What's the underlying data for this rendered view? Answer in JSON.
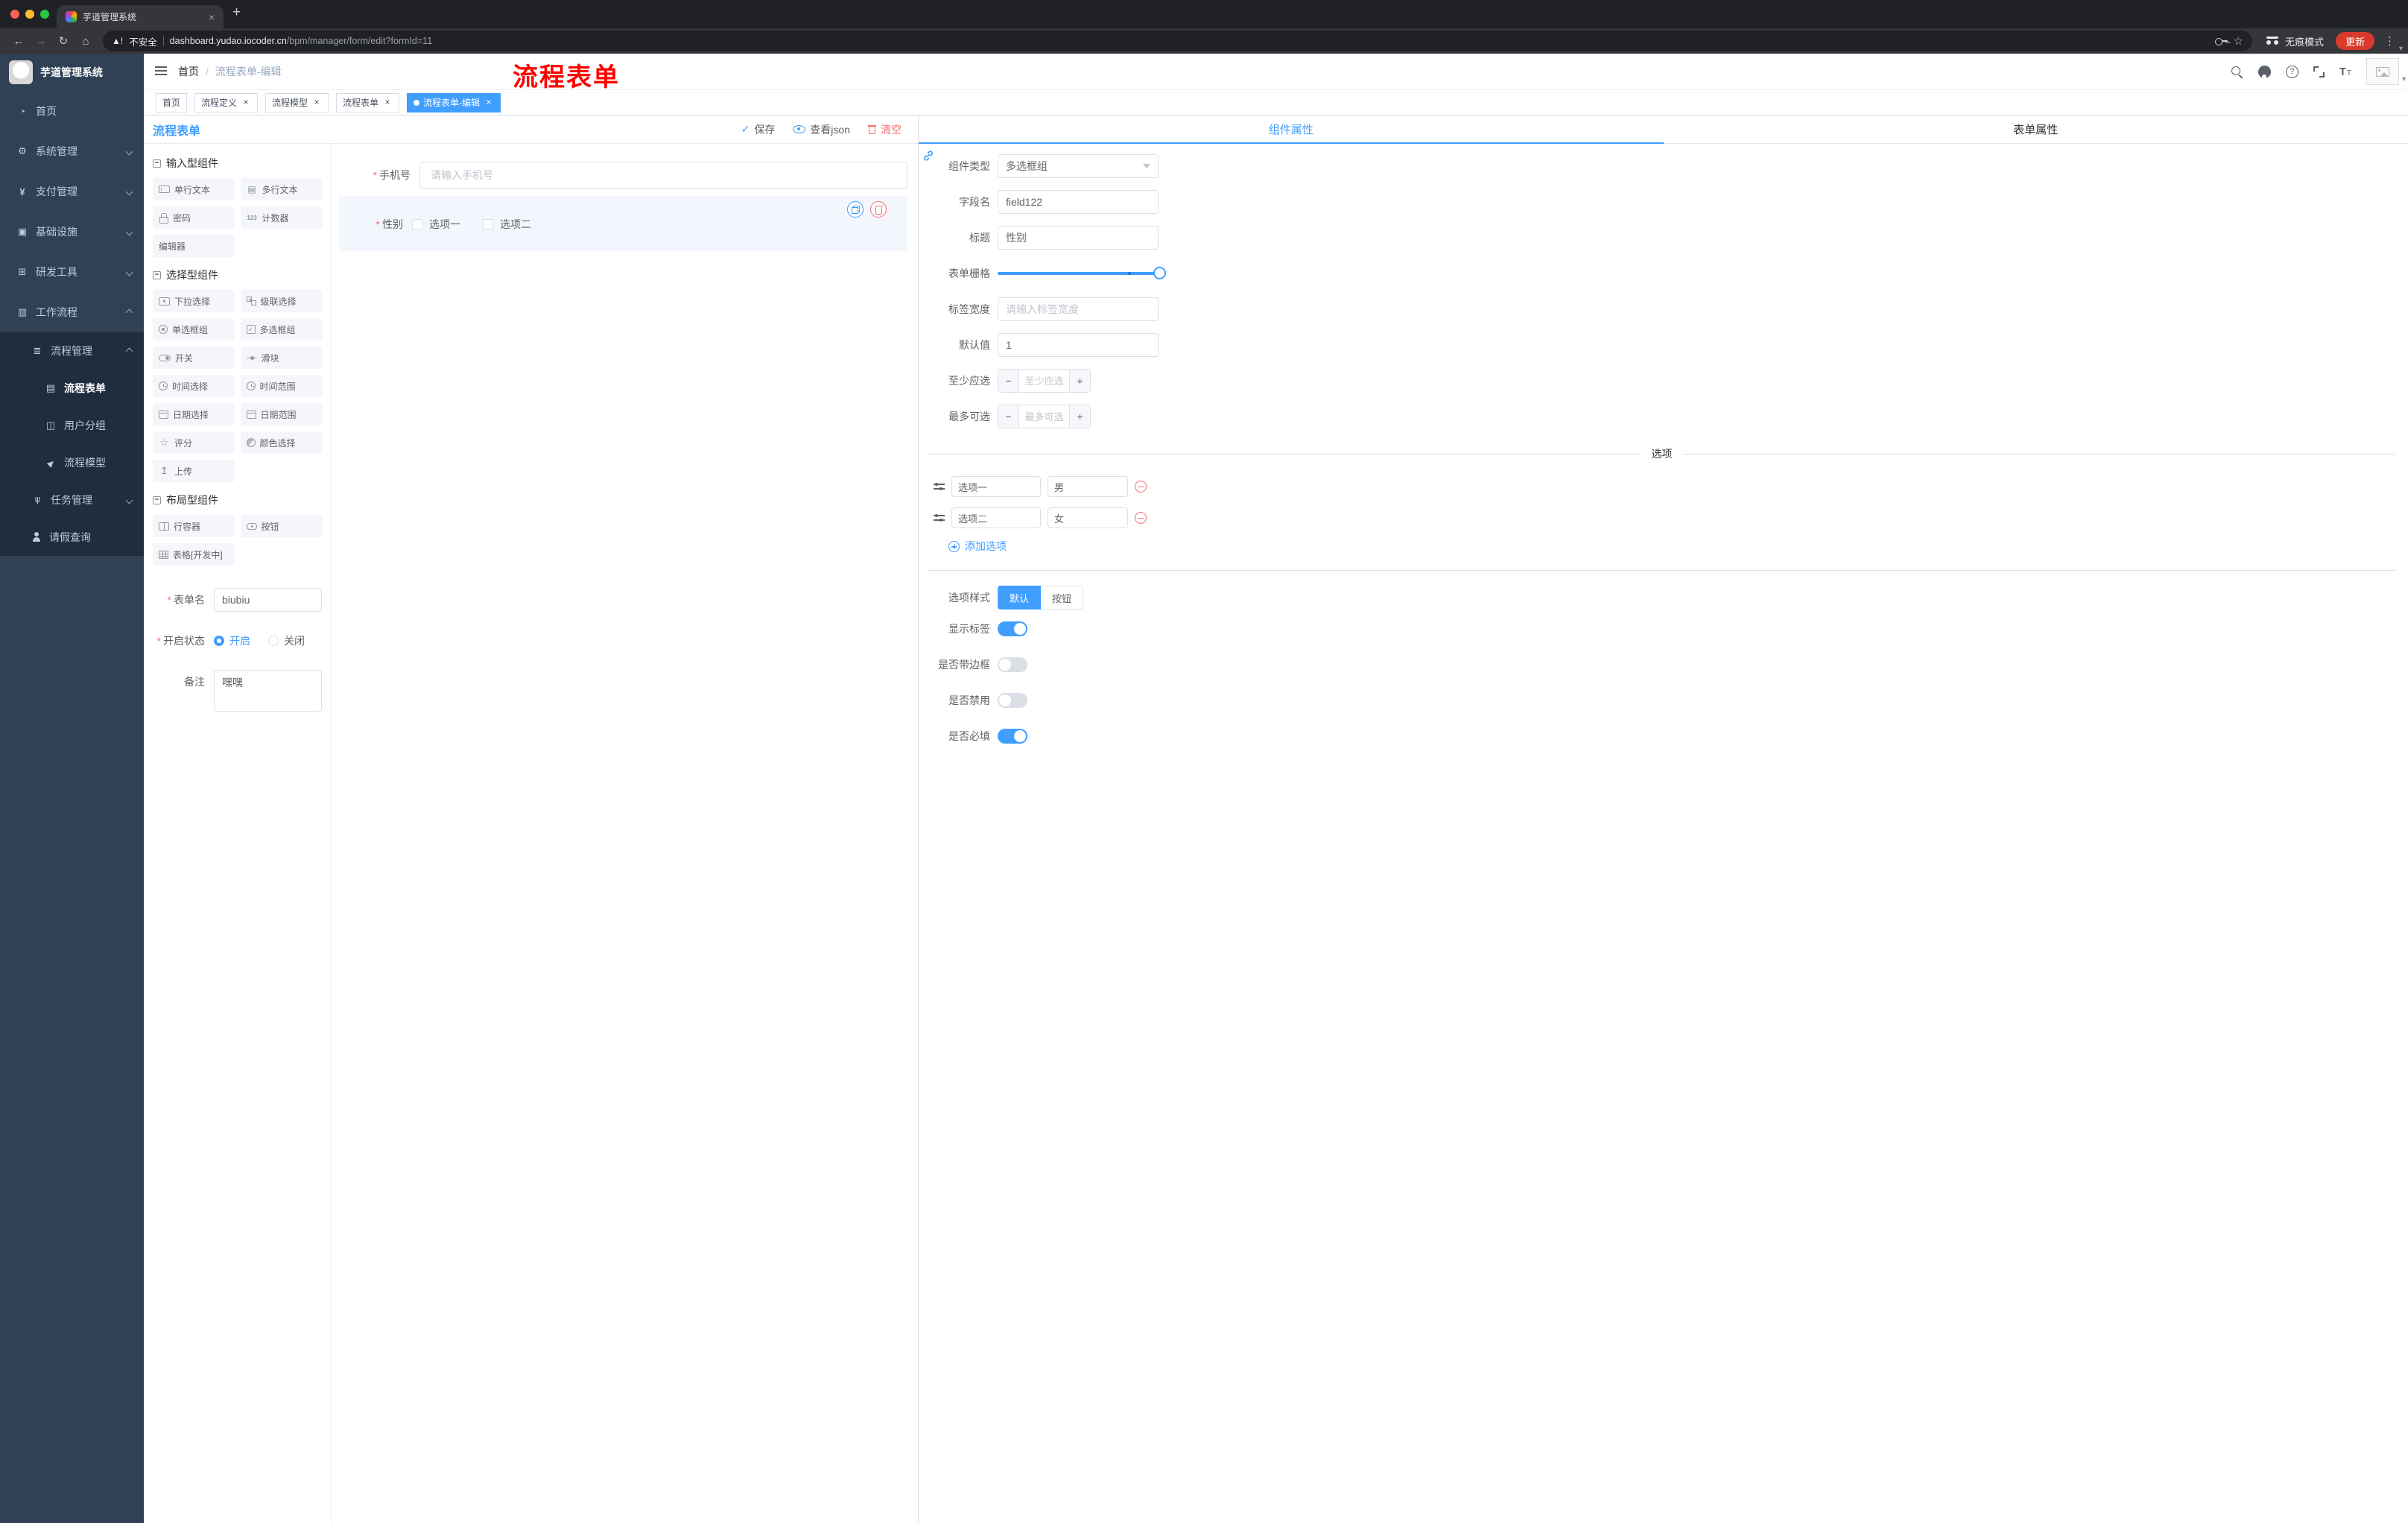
{
  "browser": {
    "tab": {
      "title": "芋道管理系统"
    },
    "address": {
      "security": "不安全",
      "domain": "dashboard.yudao.iocoder.cn",
      "path": "/bpm/manager/form/edit?formId=11",
      "incognito": "无痕模式",
      "update": "更新"
    }
  },
  "sidebar": {
    "logo": "芋道管理系统",
    "menu": [
      {
        "label": "首页",
        "icon": "dashboard"
      },
      {
        "label": "系统管理",
        "icon": "gear"
      },
      {
        "label": "支付管理",
        "icon": "yen"
      },
      {
        "label": "基础设施",
        "icon": "infrastructure"
      },
      {
        "label": "研发工具",
        "icon": "tools"
      },
      {
        "label": "工作流程",
        "icon": "workflow"
      },
      {
        "label": "流程管理",
        "icon": "list"
      },
      {
        "label": "流程表单",
        "icon": "document"
      },
      {
        "label": "用户分组",
        "icon": "users"
      },
      {
        "label": "流程模型",
        "icon": "send"
      },
      {
        "label": "任务管理",
        "icon": "branch"
      },
      {
        "label": "请假查询",
        "icon": "user"
      }
    ]
  },
  "header": {
    "breadcrumb": {
      "home": "首页",
      "current": "流程表单-编辑"
    },
    "annotation": "流程表单",
    "icon_buttons": [
      "search",
      "github",
      "help",
      "fullscreen",
      "font-size",
      "avatar"
    ]
  },
  "tags": [
    {
      "label": "首页",
      "closable": false,
      "active": false
    },
    {
      "label": "流程定义",
      "closable": true,
      "active": false
    },
    {
      "label": "流程模型",
      "closable": true,
      "active": false
    },
    {
      "label": "流程表单",
      "closable": true,
      "active": false
    },
    {
      "label": "流程表单-编辑",
      "closable": true,
      "active": true
    }
  ],
  "designer": {
    "title": "流程表单",
    "actions": {
      "save": "保存",
      "view_json": "查看json",
      "clear": "清空"
    },
    "palette": {
      "sections": [
        {
          "title": "输入型组件",
          "items": [
            {
              "label": "单行文本",
              "icon": "input"
            },
            {
              "label": "多行文本",
              "icon": "textarea"
            },
            {
              "label": "密码",
              "icon": "lock"
            },
            {
              "label": "计数器",
              "icon": "counter"
            },
            {
              "label": "编辑器",
              "icon": "editor"
            }
          ]
        },
        {
          "title": "选择型组件",
          "items": [
            {
              "label": "下拉选择",
              "icon": "select"
            },
            {
              "label": "级联选择",
              "icon": "cascader"
            },
            {
              "label": "单选框组",
              "icon": "radio"
            },
            {
              "label": "多选框组",
              "icon": "checkbox"
            },
            {
              "label": "开关",
              "icon": "switch"
            },
            {
              "label": "滑块",
              "icon": "slider"
            },
            {
              "label": "时间选择",
              "icon": "time"
            },
            {
              "label": "时间范围",
              "icon": "time-range"
            },
            {
              "label": "日期选择",
              "icon": "date"
            },
            {
              "label": "日期范围",
              "icon": "date-range"
            },
            {
              "label": "评分",
              "icon": "rate"
            },
            {
              "label": "颜色选择",
              "icon": "color"
            },
            {
              "label": "上传",
              "icon": "upload"
            }
          ]
        },
        {
          "title": "布局型组件",
          "items": [
            {
              "label": "行容器",
              "icon": "row"
            },
            {
              "label": "按钮",
              "icon": "button"
            },
            {
              "label": "表格[开发中]",
              "icon": "table"
            }
          ]
        }
      ]
    },
    "form_meta": {
      "name_label": "表单名",
      "name_value": "biubiu",
      "status_label": "开启状态",
      "status_on": "开启",
      "status_off": "关闭",
      "remark_label": "备注",
      "remark_value": "嘿嘿"
    },
    "canvas": {
      "phone": {
        "label": "手机号",
        "placeholder": "请输入手机号"
      },
      "gender": {
        "label": "性别",
        "options": [
          "选项一",
          "选项二"
        ]
      }
    }
  },
  "properties": {
    "tabs": [
      "组件属性",
      "表单属性"
    ],
    "active_tab": "组件属性",
    "fields": {
      "component_type": {
        "label": "组件类型",
        "value": "多选框组"
      },
      "field_name": {
        "label": "字段名",
        "value": "field122"
      },
      "title": {
        "label": "标题",
        "value": "性别"
      },
      "grid": {
        "label": "表单栅格"
      },
      "label_width": {
        "label": "标签宽度",
        "placeholder": "请输入标签宽度"
      },
      "default_value": {
        "label": "默认值",
        "value": "1"
      },
      "min_select": {
        "label": "至少应选",
        "placeholder": "至少应选"
      },
      "max_select": {
        "label": "最多可选",
        "placeholder": "最多可选"
      }
    },
    "options": {
      "divider": "选项",
      "rows": [
        {
          "label": "选项一",
          "value": "男"
        },
        {
          "label": "选项二",
          "value": "女"
        }
      ],
      "add": "添加选项"
    },
    "style": {
      "label": "选项样式",
      "default": "默认",
      "button": "按钮",
      "active": "默认"
    },
    "switches": [
      {
        "label": "显示标签",
        "on": true
      },
      {
        "label": "是否带边框",
        "on": false
      },
      {
        "label": "是否禁用",
        "on": false
      },
      {
        "label": "是否必填",
        "on": true
      }
    ]
  },
  "colors": {
    "primary": "#409EFF",
    "danger": "#F56C6C",
    "annotation": "#FF0000",
    "sidebar_bg": "#304156",
    "submenu_bg": "#1F2D3D",
    "update_button": "#D93A2B"
  }
}
